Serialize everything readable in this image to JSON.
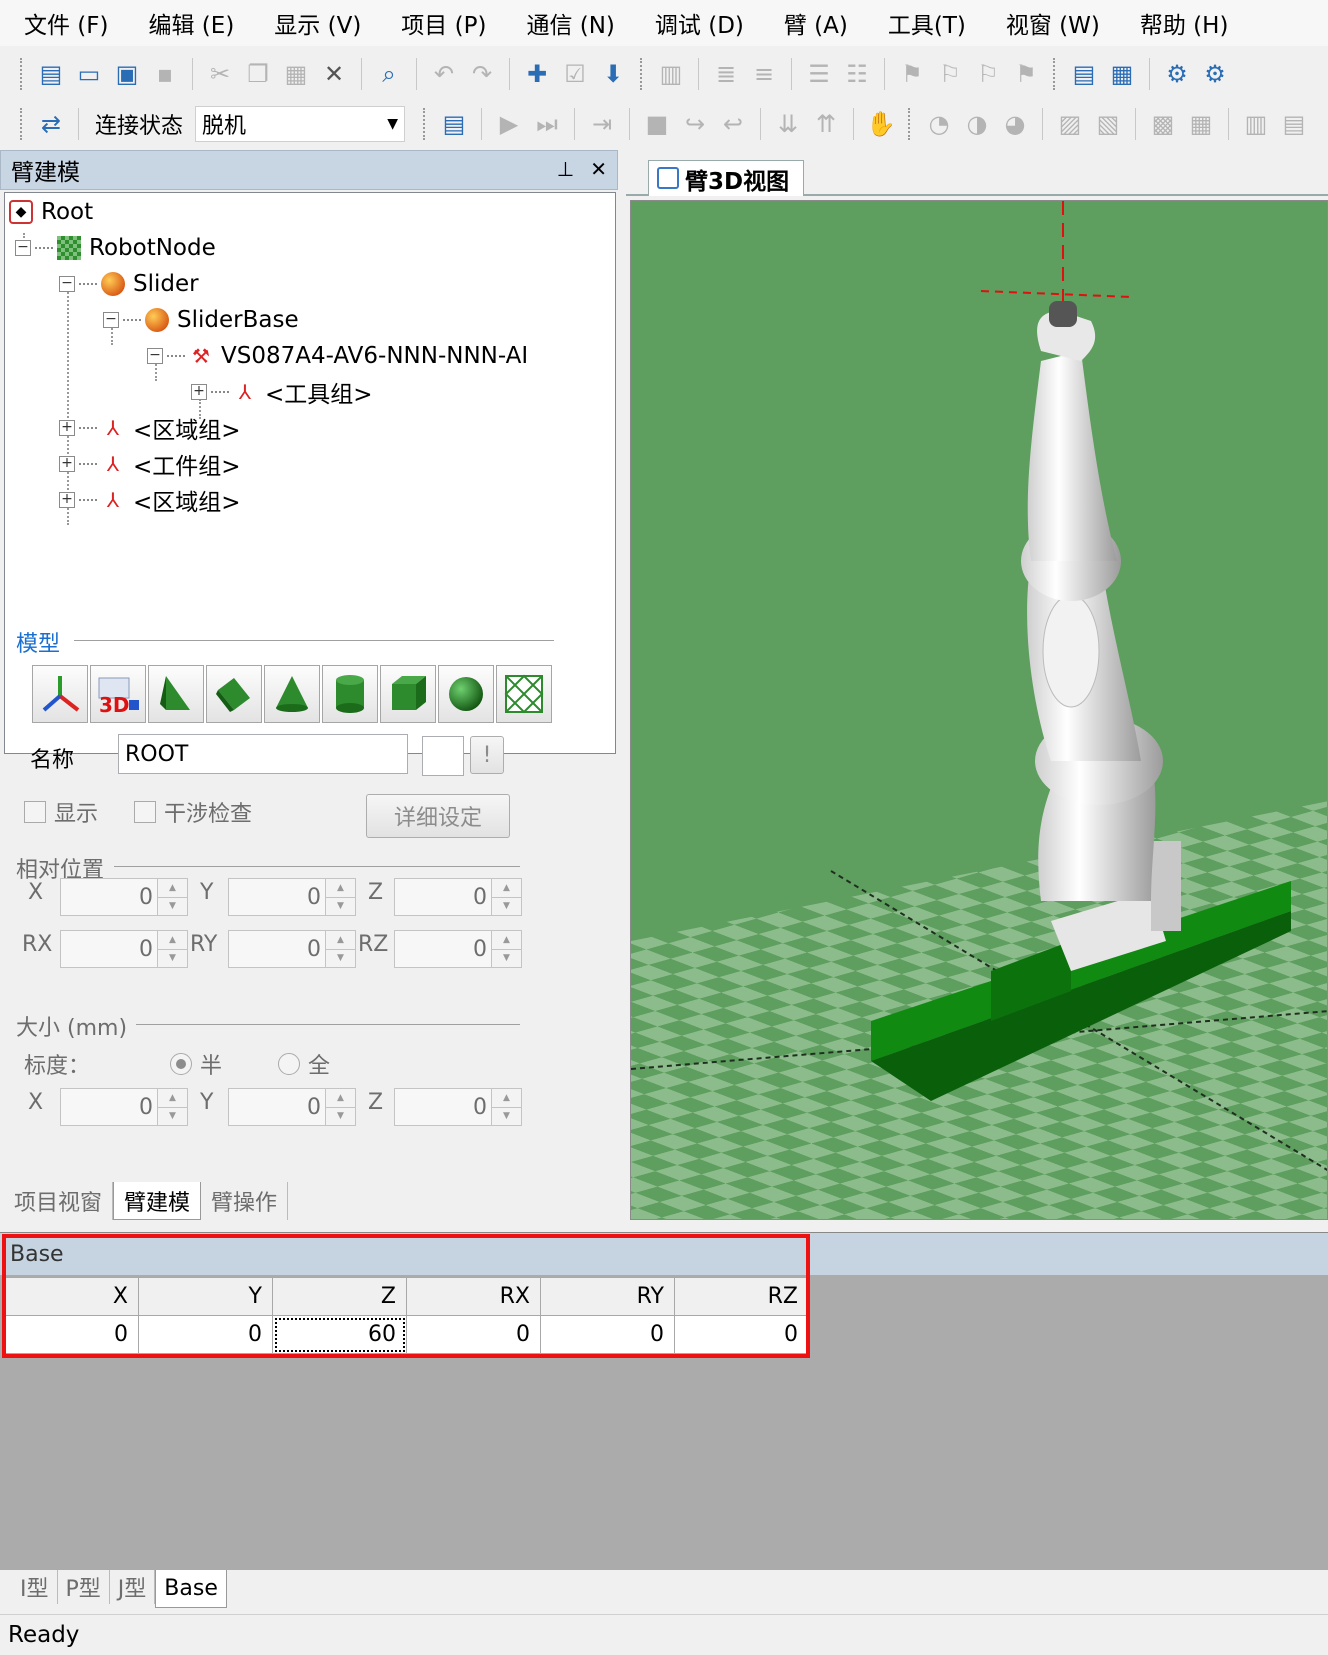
{
  "menu": [
    "文件 (F)",
    "编辑 (E)",
    "显示 (V)",
    "项目 (P)",
    "通信 (N)",
    "调试 (D)",
    "臂 (A)",
    "工具(T)",
    "视窗 (W)",
    "帮助 (H)"
  ],
  "toolbar2": {
    "conn_label": "连接状态",
    "conn_value": "脱机"
  },
  "left_panel": {
    "title": "臂建模",
    "tree": {
      "root": "Root",
      "robot_node": "RobotNode",
      "slider": "Slider",
      "slider_base": "SliderBase",
      "robot": "VS087A4-AV6-NNN-NNN-AI",
      "tool_group": "<工具组>",
      "area_group_1": "<区域组>",
      "work_group": "<工件组>",
      "area_group_2": "<区域组>"
    },
    "model_label": "模型",
    "name_label": "名称",
    "name_value": "ROOT",
    "bang_label": "!",
    "show_label": "显示",
    "interference_label": "干涉检查",
    "detail_button": "详细设定",
    "relpos_label": "相对位置",
    "relpos": {
      "x_label": "X",
      "x": "0",
      "y_label": "Y",
      "y": "0",
      "z_label": "Z",
      "z": "0",
      "rx_label": "RX",
      "rx": "0",
      "ry_label": "RY",
      "ry": "0",
      "rz_label": "RZ",
      "rz": "0"
    },
    "size_label": "大小 (mm)",
    "scale_label": "标度：",
    "scale_half": "半",
    "scale_full": "全",
    "size": {
      "x_label": "X",
      "x": "0",
      "y_label": "Y",
      "y": "0",
      "z_label": "Z",
      "z": "0"
    },
    "tabs": [
      "项目视窗",
      "臂建模",
      "臂操作"
    ]
  },
  "view": {
    "tab_label": "臂3D视图"
  },
  "base": {
    "title": "Base",
    "headers": [
      "X",
      "Y",
      "Z",
      "RX",
      "RY",
      "RZ"
    ],
    "values": [
      "0",
      "0",
      "60",
      "0",
      "0",
      "0"
    ]
  },
  "bottom_tabs": [
    "I型",
    "P型",
    "J型",
    "Base"
  ],
  "status": "Ready"
}
